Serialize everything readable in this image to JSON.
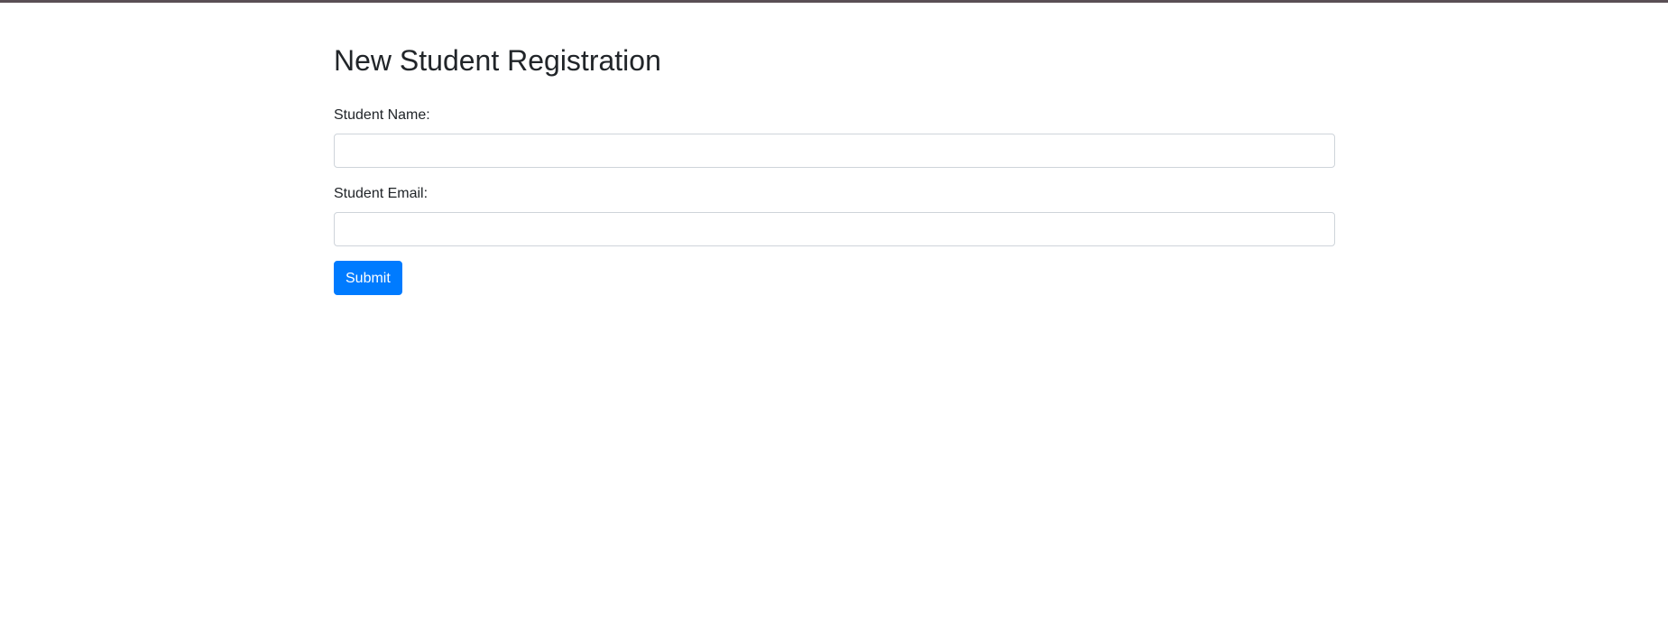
{
  "page": {
    "title": "New Student Registration"
  },
  "form": {
    "name_label": "Student Name:",
    "name_value": "",
    "email_label": "Student Email:",
    "email_value": "",
    "submit_label": "Submit"
  },
  "colors": {
    "accent": "#007bff",
    "top_border": "#5a4f55",
    "text": "#212529",
    "input_border": "#ced4da"
  }
}
